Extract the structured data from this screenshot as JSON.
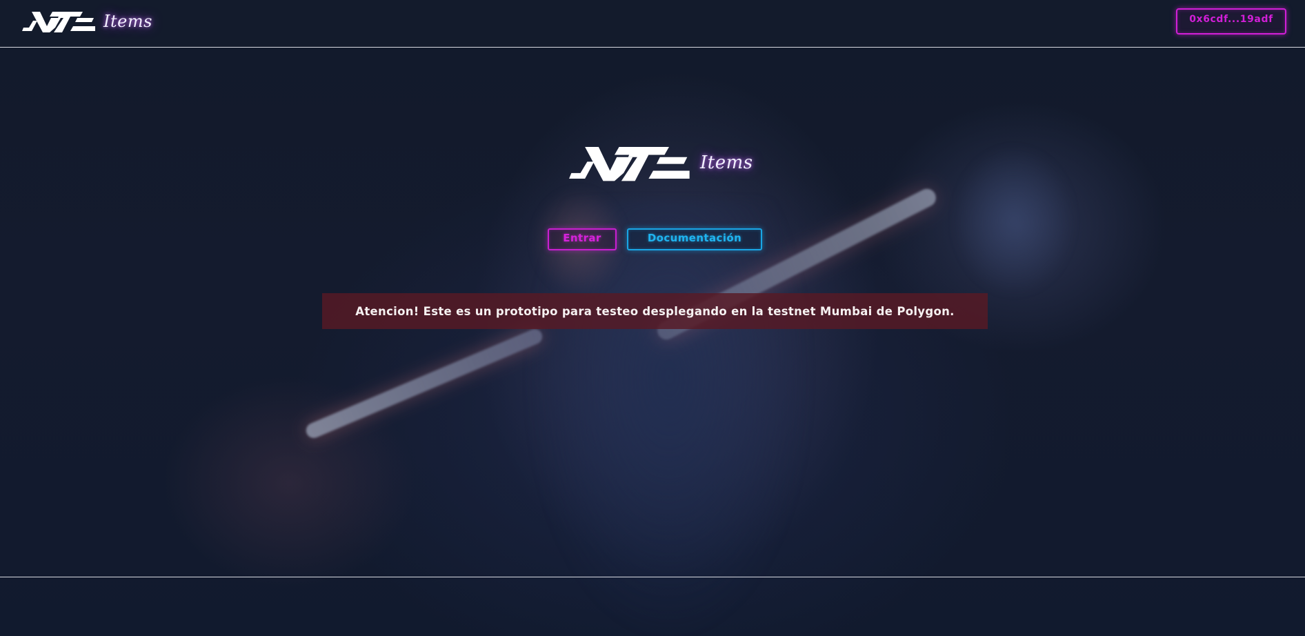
{
  "header": {
    "logo_text": "Items",
    "wallet_address": "0x6cdf...19adf"
  },
  "hero": {
    "logo_text": "Items",
    "buttons": {
      "enter_label": "Entrar",
      "docs_label": "Documentación"
    },
    "alert_text": "Atencion! Este es un prototipo para testeo desplegando en la testnet Mumbai de Polygon."
  },
  "colors": {
    "accent_magenta": "#d21fd8",
    "accent_cyan": "#1fb4f0",
    "alert_bg": "#581a24",
    "page_bg": "#131b2c"
  },
  "icons": {
    "brand_mark": "stylized-brand-glyph-icon"
  }
}
